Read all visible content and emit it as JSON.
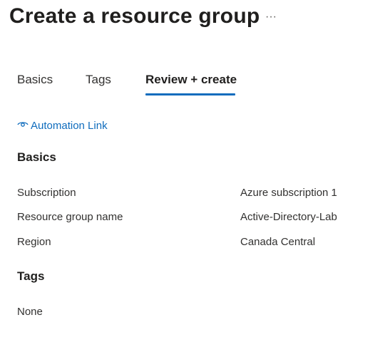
{
  "header": {
    "title": "Create a resource group",
    "more_label": "···"
  },
  "tabs": [
    {
      "label": "Basics",
      "active": false
    },
    {
      "label": "Tags",
      "active": false
    },
    {
      "label": "Review + create",
      "active": true
    }
  ],
  "automation_link": {
    "label": "Automation Link",
    "icon": "eye-icon"
  },
  "colors": {
    "accent": "#0f6cbd",
    "text": "#323130",
    "heading": "#201f1e"
  },
  "basics": {
    "heading": "Basics",
    "rows": [
      {
        "label": "Subscription",
        "value": "Azure subscription 1"
      },
      {
        "label": "Resource group name",
        "value": "Active-Directory-Lab"
      },
      {
        "label": "Region",
        "value": "Canada Central"
      }
    ]
  },
  "tags_section": {
    "heading": "Tags",
    "value": "None"
  }
}
